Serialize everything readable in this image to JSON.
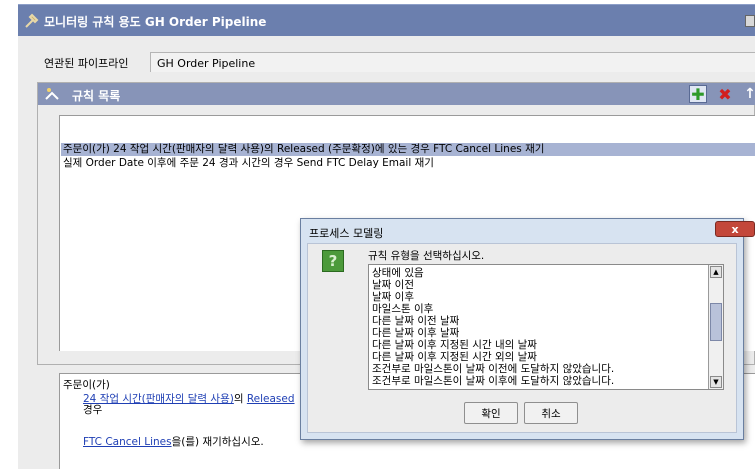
{
  "window": {
    "title": "모니터링 규칙 용도 GH Order Pipeline",
    "icon": "wrench-icon"
  },
  "pipeline": {
    "label": "연관된 파이프라인",
    "value": "GH Order Pipeline"
  },
  "rules": {
    "header": "규칙 목록",
    "header_icon": "rules-list-icon",
    "buttons": {
      "add": "add-icon",
      "delete": "delete-icon",
      "up": "arrow-up-icon",
      "down": "arrow-down-icon"
    },
    "items": [
      "주문이(가) 24 작업 시간(판매자의 달력 사용)의 Released (주문확정)에 있는 경우 FTC Cancel Lines 재기",
      "실제 Order Date 이후에 주문 24 경과 시간의 경우 Send FTC Delay Email 재기"
    ]
  },
  "description": {
    "line1": "주문이(가)",
    "line2_link": "24 작업 시간(판매자의 달력 사용)",
    "line2_mid": "의 ",
    "line2_link2": "Released",
    "line3": "경우",
    "line4_link": "FTC Cancel Lines",
    "line4_text": "을(를) 재기하십시오."
  },
  "dialog": {
    "title": "프로세스 모델링",
    "close": "x",
    "prompt": "규칙 유형을 선택하십시오.",
    "options": [
      "상태에 있음",
      "날짜 이전",
      "날짜 이후",
      "마일스톤 이후",
      "다른 날짜 이전 날짜",
      "다른 날짜 이후 날짜",
      "다른 날짜 이후 지정된 시간 내의 날짜",
      "다른 날짜 이후 지정된 시간 외의 날짜",
      "조건부로 마일스톤이 날짜 이전에 도달하지 않았습니다.",
      "조건부로 마일스톤이 날짜 이후에 도달하지 않았습니다."
    ],
    "ok": "확인",
    "cancel": "취소"
  }
}
